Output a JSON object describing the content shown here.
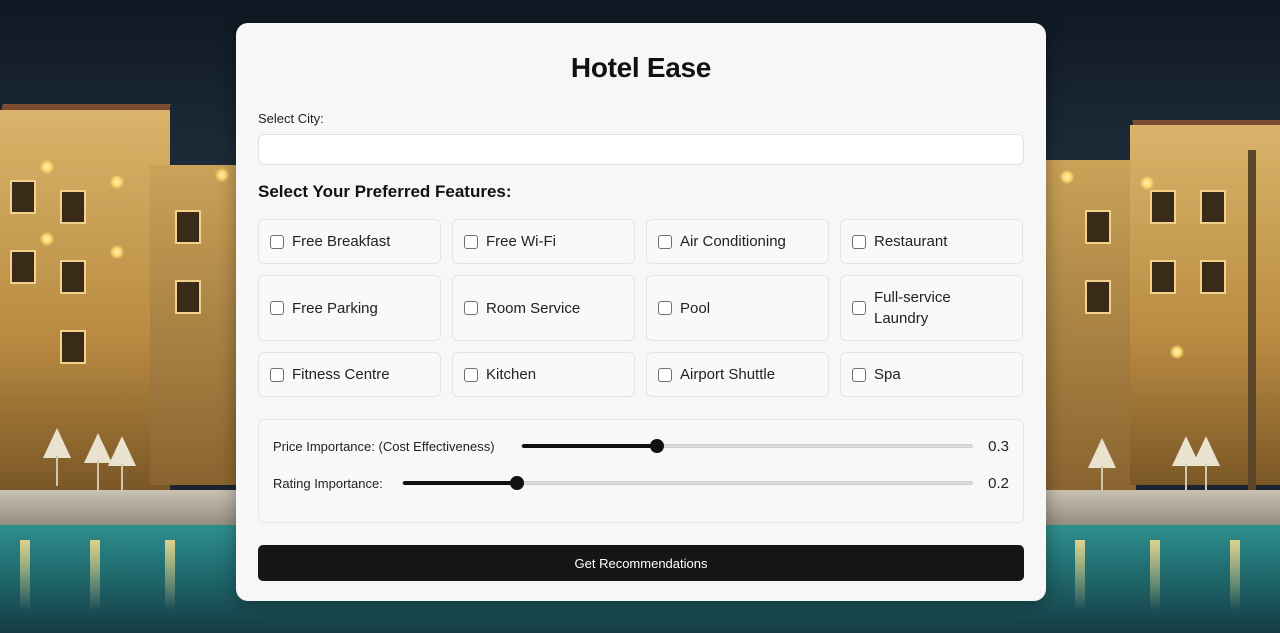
{
  "app": {
    "title": "Hotel Ease"
  },
  "city": {
    "label": "Select City:",
    "value": "",
    "placeholder": ""
  },
  "features": {
    "heading": "Select Your Preferred Features:",
    "items": [
      {
        "label": "Free Breakfast",
        "checked": false
      },
      {
        "label": "Free Wi-Fi",
        "checked": false
      },
      {
        "label": "Air Conditioning",
        "checked": false
      },
      {
        "label": "Restaurant",
        "checked": false
      },
      {
        "label": "Free Parking",
        "checked": false
      },
      {
        "label": "Room Service",
        "checked": false
      },
      {
        "label": "Pool",
        "checked": false
      },
      {
        "label": "Full-service Laundry",
        "checked": false
      },
      {
        "label": "Fitness Centre",
        "checked": false
      },
      {
        "label": "Kitchen",
        "checked": false
      },
      {
        "label": "Airport Shuttle",
        "checked": false
      },
      {
        "label": "Spa",
        "checked": false
      }
    ]
  },
  "sliders": {
    "price": {
      "label": "Price Importance: (Cost Effectiveness)",
      "value": "0.3",
      "min": 0,
      "max": 1
    },
    "rating": {
      "label": "Rating Importance:",
      "value": "0.2",
      "min": 0,
      "max": 1
    }
  },
  "actions": {
    "submit_label": "Get Recommendations"
  },
  "colors": {
    "accent": "#151517",
    "card_bg": "#f7f7f7",
    "page_bg": "#1b2430"
  }
}
